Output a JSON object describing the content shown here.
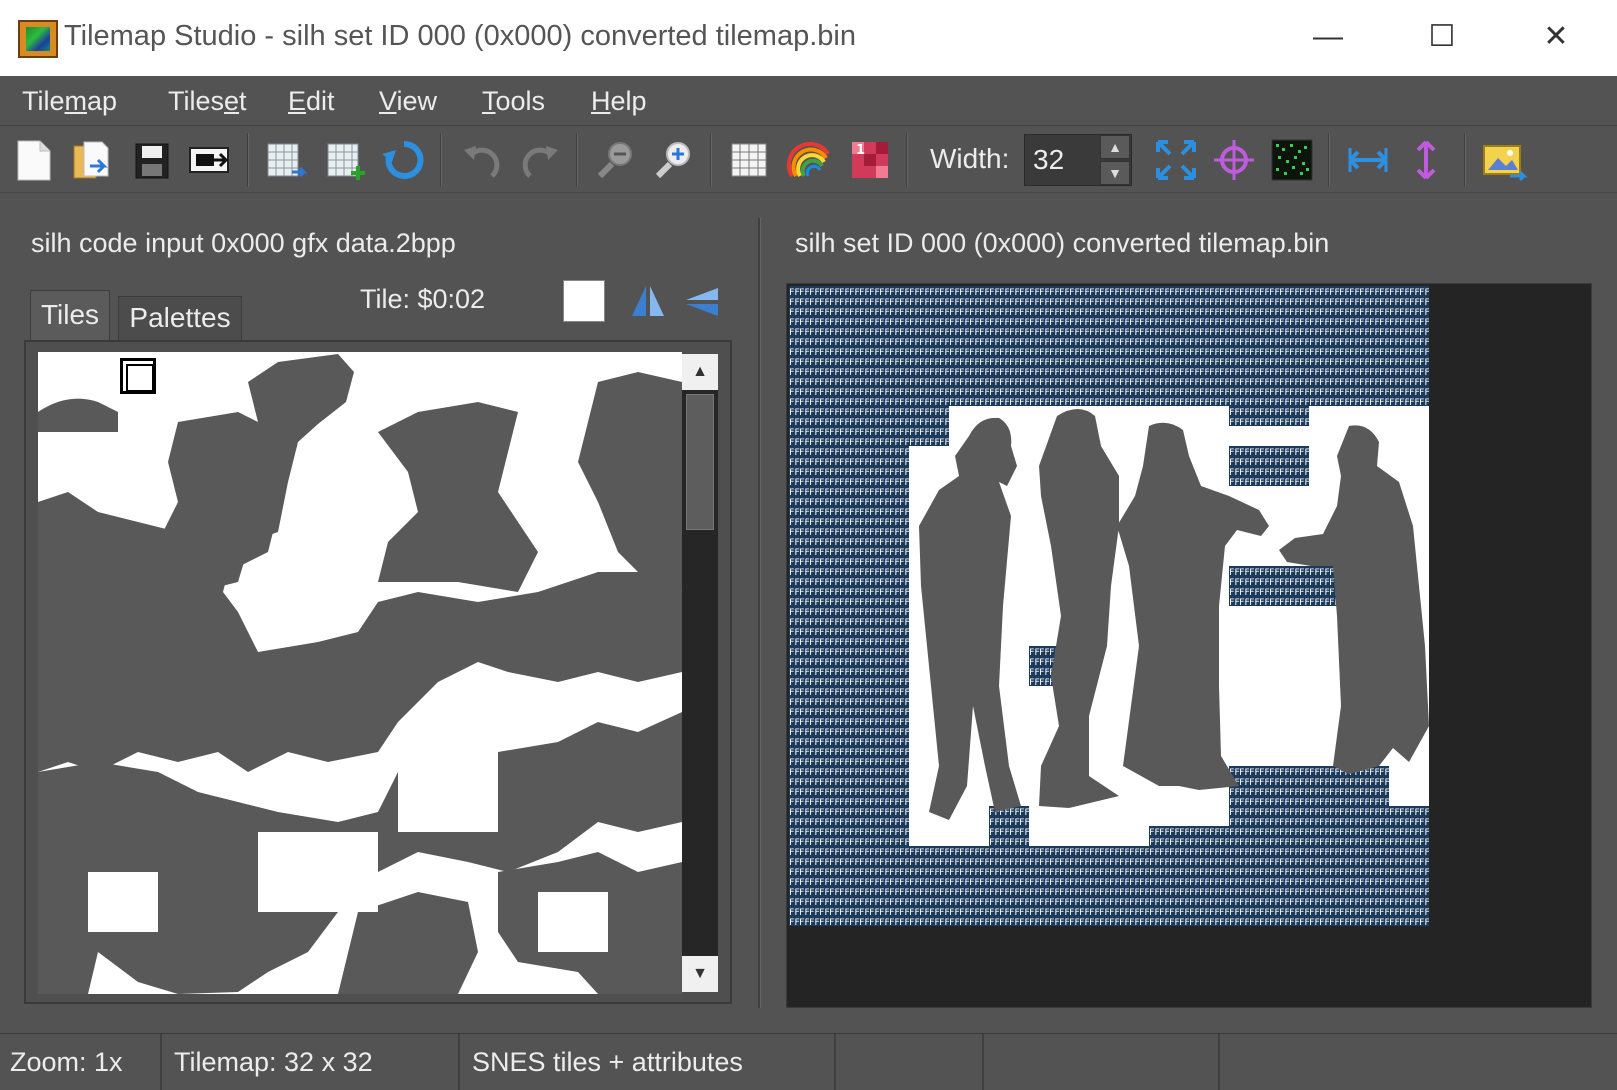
{
  "window": {
    "title": "Tilemap Studio - silh set ID 000 (0x000) converted tilemap.bin",
    "minimize_glyph": "—",
    "maximize_glyph": "☐",
    "close_glyph": "✕"
  },
  "menubar": {
    "items": [
      {
        "label": "Tilemap",
        "mnemonic_index": 4
      },
      {
        "label": "Tileset",
        "mnemonic_index": 5
      },
      {
        "label": "Edit",
        "mnemonic_index": 0
      },
      {
        "label": "View",
        "mnemonic_index": 0
      },
      {
        "label": "Tools",
        "mnemonic_index": 0
      },
      {
        "label": "Help",
        "mnemonic_index": 0
      }
    ]
  },
  "toolbar": {
    "buttons": [
      {
        "icon": "new-file-icon"
      },
      {
        "icon": "open-file-icon"
      },
      {
        "icon": "save-icon"
      },
      {
        "icon": "export-icon"
      },
      {
        "icon": "load-tileset-icon"
      },
      {
        "icon": "add-tileset-icon"
      },
      {
        "icon": "reload-icon"
      },
      {
        "icon": "undo-icon"
      },
      {
        "icon": "redo-icon"
      },
      {
        "icon": "zoom-out-icon"
      },
      {
        "icon": "zoom-in-icon"
      },
      {
        "icon": "grid-icon"
      },
      {
        "icon": "rainbow-tiles-icon"
      },
      {
        "icon": "bold-palettes-icon"
      },
      {
        "icon": "resize-icon"
      },
      {
        "icon": "reformat-icon"
      },
      {
        "icon": "tile-preview-icon"
      },
      {
        "icon": "flip-horizontal-icon"
      },
      {
        "icon": "flip-vertical-icon"
      },
      {
        "icon": "print-image-icon"
      }
    ],
    "width_label": "Width:",
    "width_value": "32"
  },
  "tileset_panel": {
    "title": "silh code input 0x000 gfx data.2bpp",
    "tabs": [
      "Tiles",
      "Palettes"
    ],
    "tile_label": "Tile: $0:02",
    "selected_color": "#ffffff"
  },
  "tilemap_panel": {
    "title": "silh set ID 000 (0x000) converted tilemap.bin",
    "empty_tile_text": "FF",
    "empty_tile_bg": "#1c3a5c"
  },
  "statusbar": {
    "zoom": "Zoom: 1x",
    "tilemap_size": "Tilemap: 32 x 32",
    "format": "SNES tiles + attributes"
  },
  "colors": {
    "silhouette": "#595959",
    "white": "#ffffff",
    "background": "#535353"
  }
}
